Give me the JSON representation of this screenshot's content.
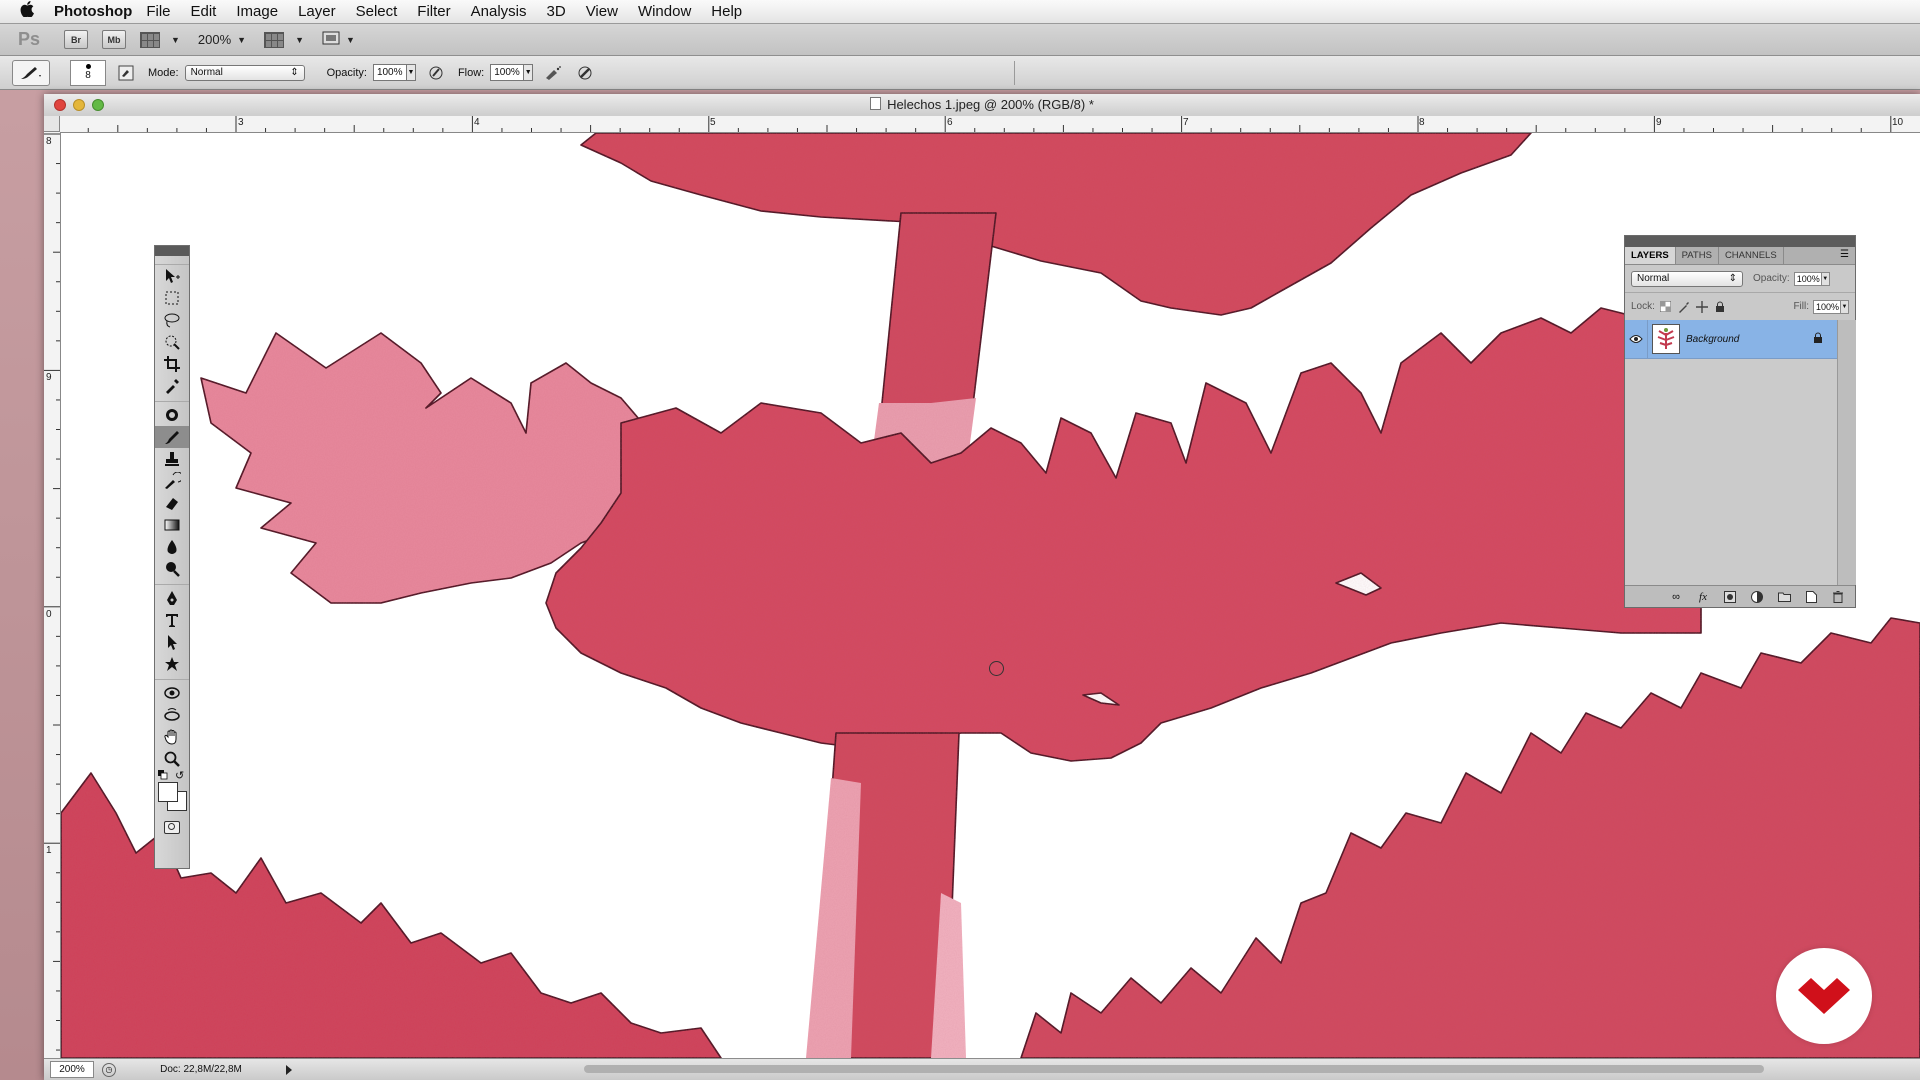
{
  "menubar": {
    "app_name": "Photoshop",
    "items": [
      "File",
      "Edit",
      "Image",
      "Layer",
      "Select",
      "Filter",
      "Analysis",
      "3D",
      "View",
      "Window",
      "Help"
    ]
  },
  "appbar": {
    "logo": "Ps",
    "bridge_label": "Br",
    "minibridge_label": "Mb",
    "zoom_level": "200%"
  },
  "options": {
    "brush_size": "8",
    "mode_label": "Mode:",
    "mode_value": "Normal",
    "opacity_label": "Opacity:",
    "opacity_value": "100%",
    "flow_label": "Flow:",
    "flow_value": "100%"
  },
  "document": {
    "title": "Helechos 1.jpeg @ 200% (RGB/8) *",
    "ruler_top": [
      "3",
      "4",
      "5",
      "6",
      "7",
      "8",
      "9",
      "10"
    ],
    "ruler_left": [
      "8",
      "9",
      "0",
      "1"
    ],
    "zoom": "200%",
    "doc_info": "Doc: 22,8M/22,8M"
  },
  "layers_panel": {
    "tabs": [
      "LAYERS",
      "PATHS",
      "CHANNELS"
    ],
    "blend_mode": "Normal",
    "opacity_label": "Opacity:",
    "opacity_value": "100%",
    "lock_label": "Lock:",
    "fill_label": "Fill:",
    "fill_value": "100%",
    "layer_name": "Background",
    "footer_fx": "fx"
  },
  "colors": {
    "fern_red": "#d24a5c",
    "fern_light": "#e98a9d",
    "selected_layer": "#88b3e6",
    "watermark": "#d0101a"
  },
  "icons": [
    "apple-icon",
    "move-tool-icon",
    "marquee-tool-icon",
    "lasso-tool-icon",
    "quick-selection-icon",
    "crop-tool-icon",
    "eyedropper-icon",
    "healing-brush-icon",
    "brush-tool-icon",
    "clone-stamp-icon",
    "history-brush-icon",
    "eraser-icon",
    "gradient-icon",
    "blur-icon",
    "dodge-icon",
    "pen-icon",
    "type-icon",
    "path-selection-icon",
    "shape-icon",
    "3d-rotate-icon",
    "3d-orbit-icon",
    "hand-icon",
    "zoom-icon",
    "eye-icon",
    "lock-icon"
  ]
}
